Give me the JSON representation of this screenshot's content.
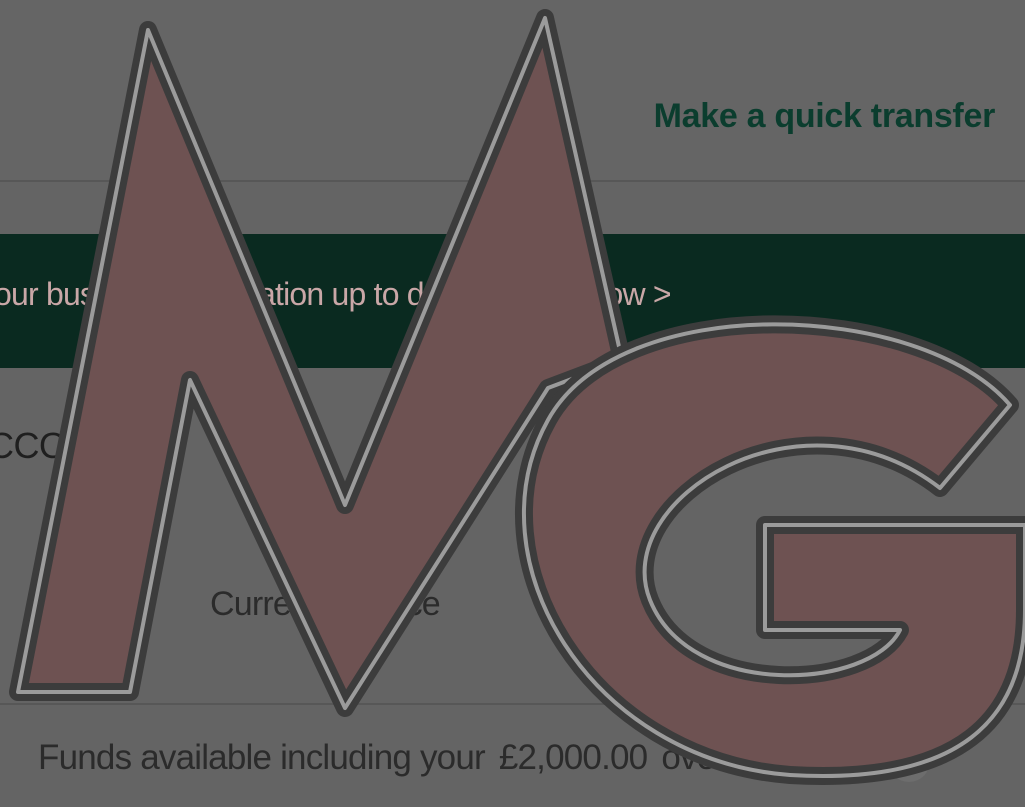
{
  "header": {
    "quick_transfer_label": "Make a quick transfer"
  },
  "banner": {
    "text": "our business information up to date. Update now >"
  },
  "account": {
    "heading": "CCOUNT",
    "current_balance_label": "Current balance",
    "funds_prefix": "Funds available including your",
    "overdraft_amount": "£2,000.00",
    "overdraft_label": "overdraft",
    "help_label": "?"
  },
  "watermark": {
    "text": "MG",
    "fill_color": "#6e5252"
  },
  "colors": {
    "background": "#646464",
    "banner": "#0a2a20",
    "link": "#0b3d2e"
  }
}
